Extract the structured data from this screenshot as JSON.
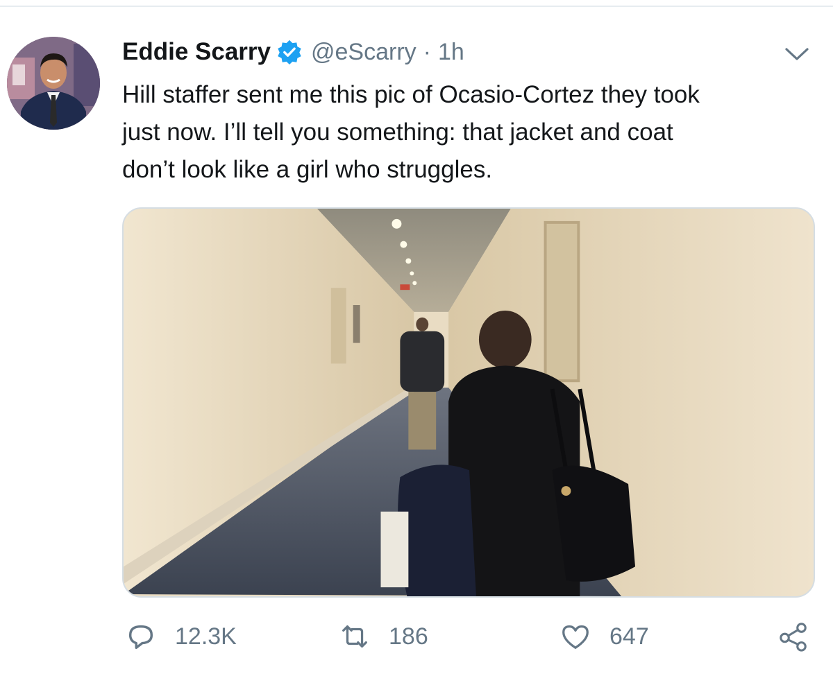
{
  "tweet": {
    "author": {
      "display_name": "Eddie Scarry",
      "handle": "@eScarry",
      "verified": true
    },
    "separator": "·",
    "time": "1h",
    "text": "Hill staffer sent me this pic of Ocasio-Cortez they took\njust now. I’ll tell you something: that jacket and coat\ndon’t look like a girl who struggles.",
    "actions": {
      "replies": "12.3K",
      "retweets": "186",
      "likes": "647"
    }
  },
  "colors": {
    "text": "#14171a",
    "secondary": "#657786",
    "verified": "#1da1f2",
    "border": "#d5dde3"
  },
  "icons": [
    "verified-badge-icon",
    "chevron-down-icon",
    "reply-icon",
    "retweet-icon",
    "like-icon",
    "share-icon"
  ]
}
